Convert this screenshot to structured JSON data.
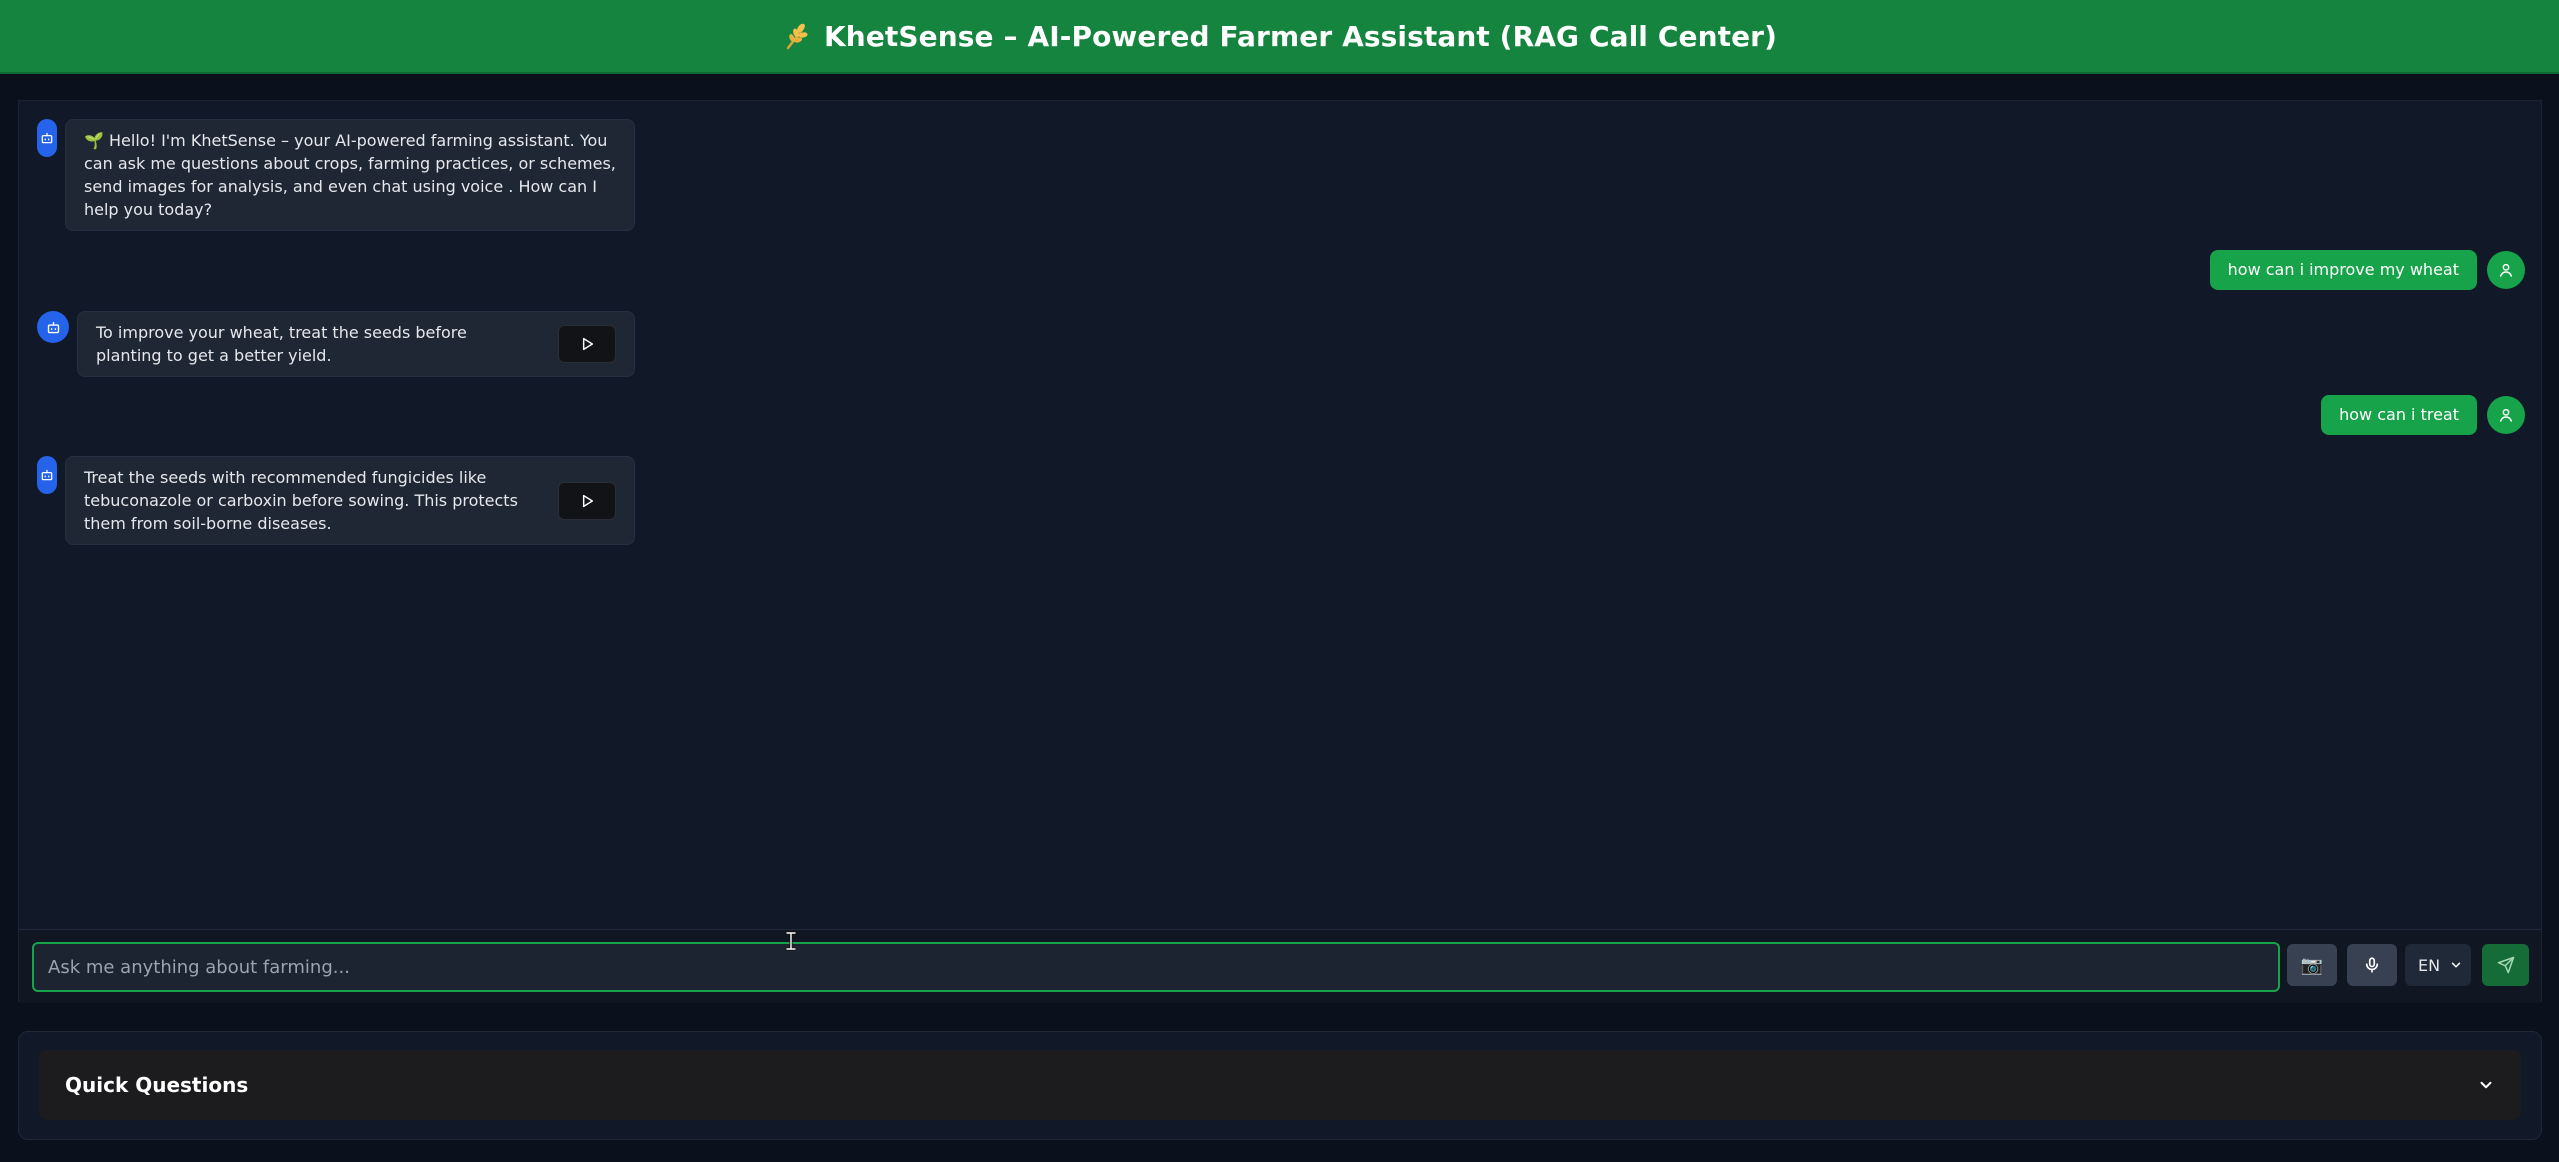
{
  "header": {
    "title": "KhetSense – AI-Powered Farmer Assistant (RAG Call Center)",
    "icon": "wheat-icon"
  },
  "messages": [
    {
      "role": "bot",
      "text": "🌱 Hello! I'm KhetSense – your AI-powered farming assistant. You can ask me questions about crops, farming practices, or schemes, send images for analysis, and even chat using voice . How can I help you today?",
      "has_play": false
    },
    {
      "role": "user",
      "text": "how can i improve my wheat"
    },
    {
      "role": "bot",
      "text": "To improve your wheat, treat the seeds before planting to get a better yield.",
      "has_play": true
    },
    {
      "role": "user",
      "text": "how can i treat"
    },
    {
      "role": "bot",
      "text": "Treat the seeds with recommended fungicides like tebuconazole or carboxin before sowing. This protects them from soil-borne diseases.",
      "has_play": true
    }
  ],
  "composer": {
    "placeholder": "Ask me anything about farming...",
    "value": "",
    "language": "EN",
    "language_options": [
      "EN"
    ],
    "camera_glyph": "📷"
  },
  "quick_questions": {
    "title": "Quick Questions",
    "expanded": false
  },
  "colors": {
    "header_bg": "#15843f",
    "page_bg": "#0b111c",
    "panel_bg": "#111827",
    "bot_bubble": "#1f2735",
    "user_bubble": "#16a34a",
    "bot_avatar": "#2563eb",
    "accent": "#16a34a"
  }
}
